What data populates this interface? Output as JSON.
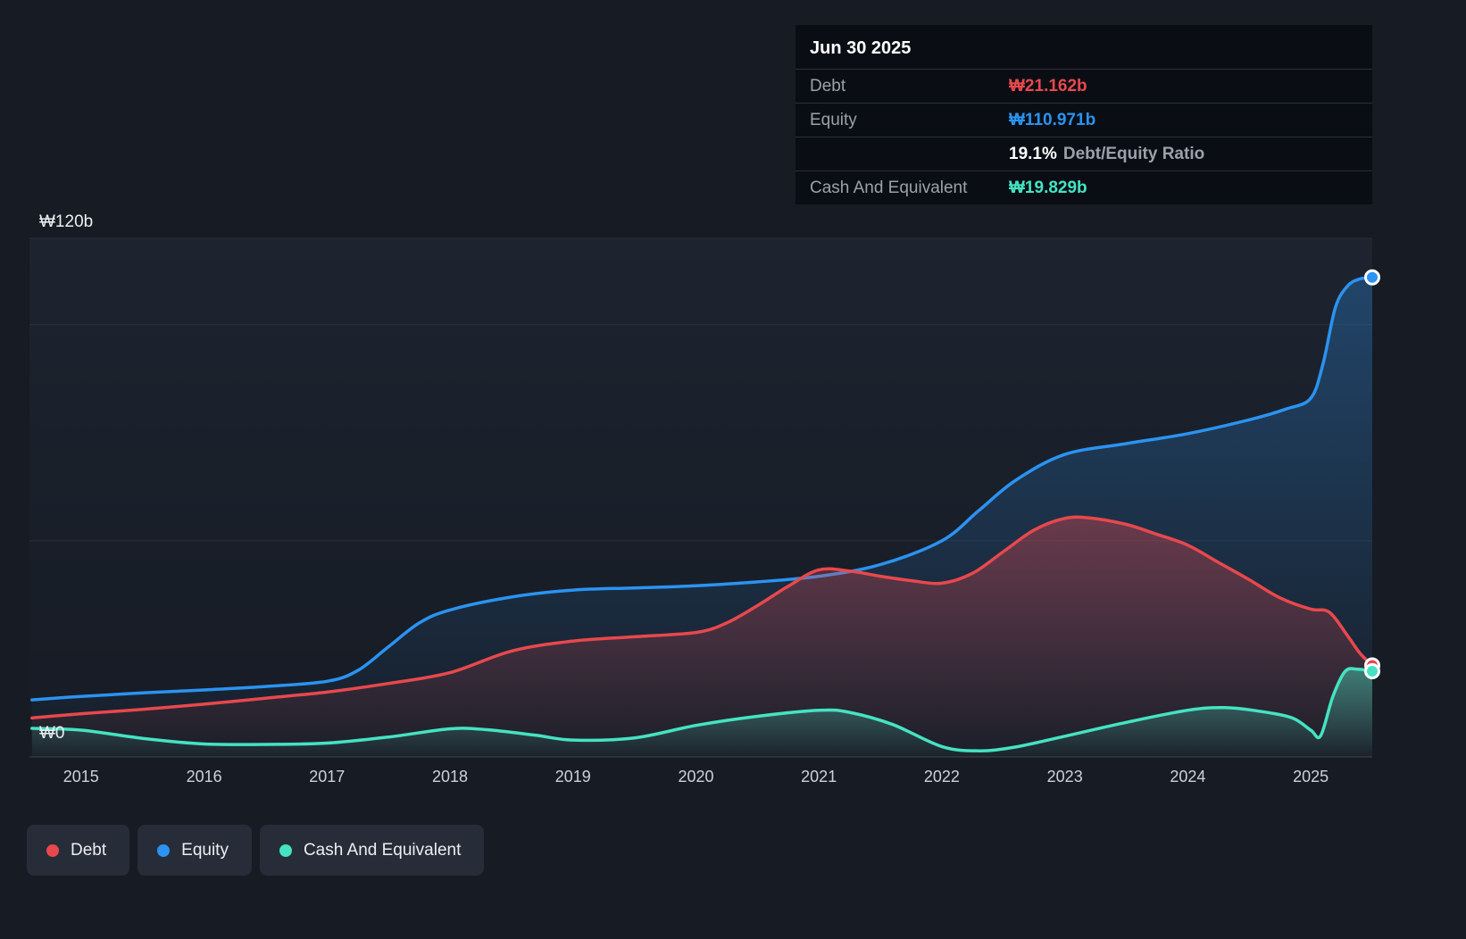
{
  "tooltip": {
    "date": "Jun 30 2025",
    "debt_label": "Debt",
    "debt_value": "₩21.162b",
    "equity_label": "Equity",
    "equity_value": "₩110.971b",
    "ratio_value": "19.1%",
    "ratio_label": "Debt/Equity Ratio",
    "cash_label": "Cash And Equivalent",
    "cash_value": "₩19.829b"
  },
  "axis": {
    "y_top_label": "₩120b",
    "y_zero_label": "₩0",
    "x_labels": [
      "2015",
      "2016",
      "2017",
      "2018",
      "2019",
      "2020",
      "2021",
      "2022",
      "2023",
      "2024",
      "2025"
    ]
  },
  "legend": {
    "items": [
      {
        "label": "Debt",
        "color": "#e8484d"
      },
      {
        "label": "Equity",
        "color": "#2b93f1"
      },
      {
        "label": "Cash And Equivalent",
        "color": "#45e3c2"
      }
    ]
  },
  "chart_data": {
    "type": "area",
    "x_range": [
      2014.58,
      2025.5
    ],
    "ylim": [
      0,
      120
    ],
    "y_unit": "billions KRW (₩b)",
    "gridlines": [
      0,
      50,
      100,
      120
    ],
    "x_ticks": [
      2015,
      2016,
      2017,
      2018,
      2019,
      2020,
      2021,
      2022,
      2023,
      2024,
      2025
    ],
    "legend_position": "bottom-left",
    "series": [
      {
        "name": "Equity",
        "color": "#2b93f1",
        "end_value": 110.971,
        "points": [
          [
            2014.6,
            13.2
          ],
          [
            2015,
            14
          ],
          [
            2015.5,
            14.8
          ],
          [
            2016,
            15.5
          ],
          [
            2016.5,
            16.3
          ],
          [
            2017,
            17.5
          ],
          [
            2017.25,
            20
          ],
          [
            2017.5,
            25.5
          ],
          [
            2017.75,
            31
          ],
          [
            2018,
            34
          ],
          [
            2018.5,
            37
          ],
          [
            2019,
            38.6
          ],
          [
            2019.5,
            39.1
          ],
          [
            2020,
            39.6
          ],
          [
            2020.5,
            40.5
          ],
          [
            2021,
            41.8
          ],
          [
            2021.5,
            44.5
          ],
          [
            2022,
            50
          ],
          [
            2022.3,
            57
          ],
          [
            2022.6,
            64
          ],
          [
            2023,
            70
          ],
          [
            2023.5,
            72.5
          ],
          [
            2024,
            74.8
          ],
          [
            2024.5,
            78
          ],
          [
            2024.8,
            80.5
          ],
          [
            2025,
            83
          ],
          [
            2025.1,
            91
          ],
          [
            2025.2,
            104
          ],
          [
            2025.3,
            109
          ],
          [
            2025.4,
            110.6
          ],
          [
            2025.5,
            110.971
          ]
        ]
      },
      {
        "name": "Debt",
        "color": "#e8484d",
        "end_value": 21.162,
        "points": [
          [
            2014.6,
            9
          ],
          [
            2015,
            10
          ],
          [
            2015.5,
            11
          ],
          [
            2016,
            12.2
          ],
          [
            2016.5,
            13.6
          ],
          [
            2017,
            15
          ],
          [
            2017.5,
            17
          ],
          [
            2018,
            19.5
          ],
          [
            2018.5,
            24.5
          ],
          [
            2019,
            26.8
          ],
          [
            2019.5,
            27.8
          ],
          [
            2020,
            28.8
          ],
          [
            2020.25,
            31
          ],
          [
            2020.5,
            35
          ],
          [
            2020.75,
            39.5
          ],
          [
            2021,
            43.3
          ],
          [
            2021.25,
            43
          ],
          [
            2021.5,
            41.8
          ],
          [
            2021.75,
            40.8
          ],
          [
            2022,
            40.2
          ],
          [
            2022.25,
            42.5
          ],
          [
            2022.5,
            47.5
          ],
          [
            2022.75,
            52.5
          ],
          [
            2023,
            55.2
          ],
          [
            2023.2,
            55.3
          ],
          [
            2023.5,
            53.8
          ],
          [
            2023.75,
            51.5
          ],
          [
            2024,
            49
          ],
          [
            2024.25,
            45
          ],
          [
            2024.5,
            41
          ],
          [
            2024.75,
            36.8
          ],
          [
            2025,
            34.2
          ],
          [
            2025.15,
            33.5
          ],
          [
            2025.3,
            28
          ],
          [
            2025.4,
            24
          ],
          [
            2025.5,
            21.162
          ]
        ]
      },
      {
        "name": "Cash And Equivalent",
        "color": "#45e3c2",
        "end_value": 19.829,
        "points": [
          [
            2014.6,
            6.6
          ],
          [
            2015,
            6.2
          ],
          [
            2015.5,
            4.3
          ],
          [
            2016,
            3
          ],
          [
            2016.5,
            2.9
          ],
          [
            2017,
            3.2
          ],
          [
            2017.5,
            4.6
          ],
          [
            2018,
            6.5
          ],
          [
            2018.3,
            6.3
          ],
          [
            2018.7,
            5
          ],
          [
            2019,
            3.9
          ],
          [
            2019.5,
            4.4
          ],
          [
            2020,
            7.3
          ],
          [
            2020.5,
            9.4
          ],
          [
            2021,
            10.8
          ],
          [
            2021.25,
            10.3
          ],
          [
            2021.6,
            7.5
          ],
          [
            2022,
            2.4
          ],
          [
            2022.3,
            1.4
          ],
          [
            2022.6,
            2.3
          ],
          [
            2023,
            4.8
          ],
          [
            2023.5,
            8
          ],
          [
            2024,
            10.8
          ],
          [
            2024.3,
            11.4
          ],
          [
            2024.6,
            10.5
          ],
          [
            2024.85,
            9
          ],
          [
            2025,
            6.2
          ],
          [
            2025.08,
            4.9
          ],
          [
            2025.18,
            14
          ],
          [
            2025.28,
            19.8
          ],
          [
            2025.38,
            20.3
          ],
          [
            2025.5,
            19.829
          ]
        ]
      }
    ]
  }
}
